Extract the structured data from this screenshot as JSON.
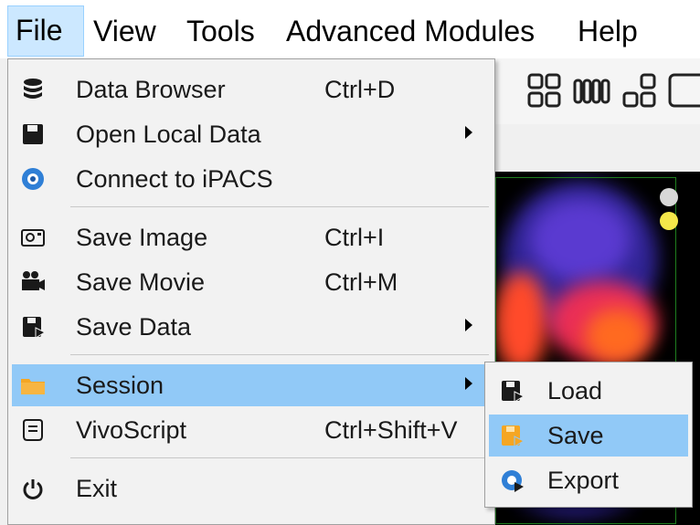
{
  "menubar": {
    "items": [
      {
        "label": "File",
        "active": true
      },
      {
        "label": "View"
      },
      {
        "label": "Tools"
      },
      {
        "label": "Advanced Modules"
      },
      {
        "label": "Help"
      }
    ]
  },
  "file_menu": {
    "items": [
      {
        "label": "Data Browser",
        "shortcut": "Ctrl+D",
        "icon": "database-icon"
      },
      {
        "label": "Open Local Data",
        "shortcut": "",
        "icon": "floppy-disk-icon",
        "submenu": true
      },
      {
        "label": "Connect to iPACS",
        "shortcut": "",
        "icon": "ipacs-icon"
      },
      {
        "label": "Save Image",
        "shortcut": "Ctrl+I",
        "icon": "camera-icon"
      },
      {
        "label": "Save Movie",
        "shortcut": "Ctrl+M",
        "icon": "movie-camera-icon"
      },
      {
        "label": "Save Data",
        "shortcut": "",
        "icon": "save-data-icon",
        "submenu": true
      },
      {
        "label": "Session",
        "shortcut": "",
        "icon": "folder-icon",
        "submenu": true,
        "highlighted": true
      },
      {
        "label": "VivoScript",
        "shortcut": "Ctrl+Shift+V",
        "icon": "script-icon"
      },
      {
        "label": "Exit",
        "shortcut": "",
        "icon": "power-icon"
      }
    ]
  },
  "session_submenu": {
    "items": [
      {
        "label": "Load",
        "icon": "load-icon"
      },
      {
        "label": "Save",
        "icon": "save-icon",
        "highlighted": true
      },
      {
        "label": "Export",
        "icon": "export-icon"
      }
    ]
  },
  "colors": {
    "highlight": "#91c9f7",
    "menubar_active": "#cce8ff",
    "menu_bg": "#f2f2f2",
    "session_folder": "#f5a623",
    "ipacs_blue": "#2f7fd6",
    "viewer_frame": "#1e7e1e"
  }
}
